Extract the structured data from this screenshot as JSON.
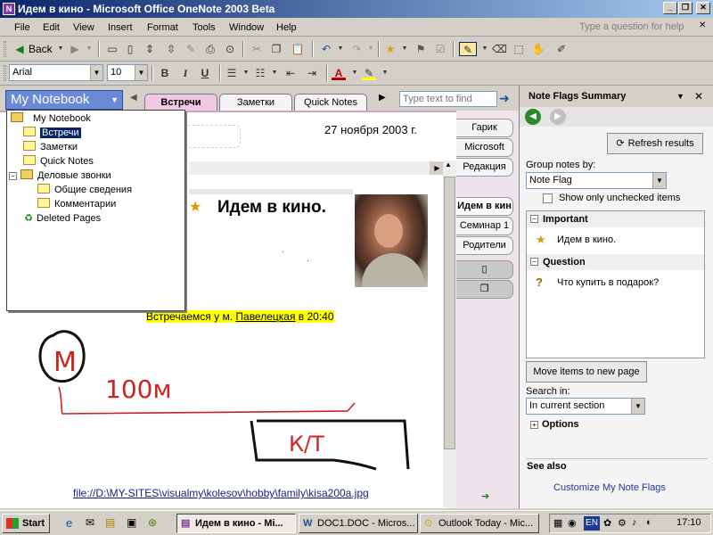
{
  "window": {
    "title": "Идем в кино - Microsoft Office OneNote 2003 Beta",
    "app_icon": "N",
    "minimize": "_",
    "restore": "❐",
    "close": "✕"
  },
  "menu": {
    "items": [
      "File",
      "Edit",
      "View",
      "Insert",
      "Format",
      "Tools",
      "Window",
      "Help"
    ],
    "ask_placeholder": "Type a question for help",
    "close_glyph": "✕"
  },
  "toolbar": {
    "back_label": "Back",
    "font_name": "Arial",
    "font_size": "10"
  },
  "notebook": {
    "button_label": "My Notebook",
    "section_tabs": [
      "Встречи",
      "Заметки",
      "Quick Notes"
    ],
    "find_placeholder": "Type text to find",
    "tree": [
      {
        "label": "My Notebook",
        "type": "folder",
        "level": 0,
        "expander": "−"
      },
      {
        "label": "Встречи",
        "type": "section",
        "level": 1,
        "selected": true
      },
      {
        "label": "Заметки",
        "type": "section",
        "level": 1
      },
      {
        "label": "Quick Notes",
        "type": "section",
        "level": 1
      },
      {
        "label": "Деловые звонки",
        "type": "folder",
        "level": 1,
        "expander": "−"
      },
      {
        "label": "Общие сведения",
        "type": "section",
        "level": 2
      },
      {
        "label": "Комментарии",
        "type": "section",
        "level": 2
      },
      {
        "label": "Deleted Pages",
        "type": "trash",
        "level": 1
      }
    ]
  },
  "page": {
    "date": "27 ноября 2003 г.",
    "title": "Идем в кино.",
    "highlight_prefix": "Встречаемся у м. ",
    "highlight_link": "Павелецкая",
    "highlight_suffix": " в 20:40",
    "file_link": "file://D:\\MY-SITES\\visualmy\\kolesov\\hobby\\family\\kisa200a.jpg",
    "ink_labels": [
      "M",
      "100м",
      "К/Т"
    ]
  },
  "page_tabs": [
    "Гарик",
    "Microsoft",
    "Редакция",
    "Идем в кин",
    "Семинар 1",
    "Родители"
  ],
  "taskpane": {
    "title": "Note Flags Summary",
    "refresh_label": "Refresh results",
    "group_by_label": "Group notes by:",
    "group_by_value": "Note Flag",
    "only_unchecked_label": "Show only unchecked items",
    "groups": [
      {
        "name": "Important",
        "icon": "star-icon",
        "item": "Идем в кино."
      },
      {
        "name": "Question",
        "icon": "question-icon",
        "item": "Что купить в подарок?"
      }
    ],
    "move_label": "Move items to new page",
    "search_in_label": "Search in:",
    "search_in_value": "In current section",
    "options_label": "Options",
    "see_also_label": "See also",
    "customize_link": "Customize My Note Flags"
  },
  "taskbar": {
    "start_label": "Start",
    "tasks": [
      "Идем в кино - Mi...",
      "DOC1.DOC - Micros...",
      "Outlook Today - Mic..."
    ],
    "lang": "EN",
    "clock": "17:10"
  },
  "colors": {
    "title_gradient_start": "#0a246a",
    "notebook_button": "#6a8ad6",
    "highlight": "#ffff00",
    "ink": "#cc2222"
  }
}
